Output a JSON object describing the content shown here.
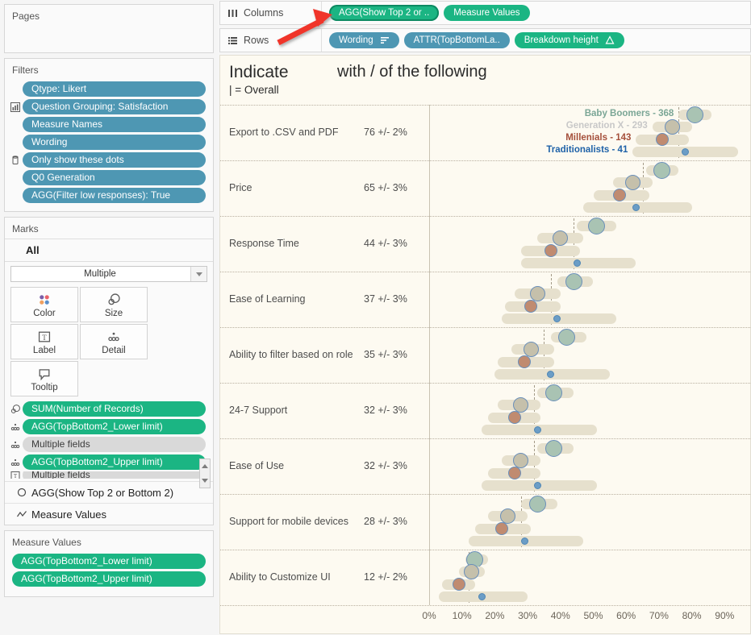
{
  "left_pane": {
    "pages": {
      "title": "Pages"
    },
    "filters": {
      "title": "Filters",
      "items": [
        {
          "label": "Qtype: Likert",
          "icon": "",
          "style": "blue"
        },
        {
          "label": "Question Grouping: Satisfaction",
          "icon": "chart-icon",
          "style": "blue"
        },
        {
          "label": "Measure Names",
          "icon": "",
          "style": "blue"
        },
        {
          "label": "Wording",
          "icon": "",
          "style": "blue"
        },
        {
          "label": "Only show these dots",
          "icon": "database-icon",
          "style": "blue"
        },
        {
          "label": "Q0 Generation",
          "icon": "",
          "style": "blue"
        },
        {
          "label": "AGG(Filter low responses): True",
          "icon": "",
          "style": "blue"
        }
      ]
    },
    "marks": {
      "title": "Marks",
      "all_label": "All",
      "mark_type": "Multiple",
      "buttons": [
        {
          "label": "Color",
          "icon": "color-dots-icon"
        },
        {
          "label": "Size",
          "icon": "size-circles-icon"
        },
        {
          "label": "Label",
          "icon": "label-text-icon"
        },
        {
          "label": "Detail",
          "icon": "detail-dots-icon"
        },
        {
          "label": "Tooltip",
          "icon": "tooltip-bubble-icon"
        }
      ],
      "pills": [
        {
          "label": "SUM(Number of Records)",
          "icon": "size-circles-icon",
          "style": "green"
        },
        {
          "label": "AGG(TopBottom2_Lower limit)",
          "icon": "detail-dots-icon",
          "style": "green"
        },
        {
          "label": "Multiple fields",
          "icon": "detail-dots-icon",
          "style": "grey"
        },
        {
          "label": "AGG(TopBottom2_Upper limit)",
          "icon": "detail-dots-icon",
          "style": "green"
        },
        {
          "label": "Multiple fields",
          "icon": "label-text-icon",
          "style": "grey"
        }
      ],
      "extra_rows": [
        {
          "label": "AGG(Show Top 2 or Bottom 2)",
          "icon": "circle-outline-icon"
        },
        {
          "label": "Measure Values",
          "icon": "line-chart-icon"
        }
      ]
    },
    "measure_values": {
      "title": "Measure Values",
      "items": [
        {
          "label": "AGG(TopBottom2_Lower limit)",
          "style": "green"
        },
        {
          "label": "AGG(TopBottom2_Upper limit)",
          "style": "green"
        }
      ]
    }
  },
  "shelves": {
    "columns": {
      "label": "Columns",
      "icon": "columns-icon",
      "pills": [
        {
          "label": "AGG(Show Top 2 or ..",
          "style": "green",
          "selected": true
        },
        {
          "label": "Measure Values",
          "style": "green",
          "selected": false
        }
      ]
    },
    "rows": {
      "label": "Rows",
      "icon": "rows-icon",
      "pills": [
        {
          "label": "Wording",
          "style": "blue",
          "selected": false,
          "badge": "sort-icon"
        },
        {
          "label": "ATTR(TopBottomLa..",
          "style": "blue",
          "selected": false
        },
        {
          "label": "Breakdown height",
          "style": "green",
          "selected": false,
          "badge": "delta-icon"
        }
      ]
    }
  },
  "annotation": {
    "arrow_color": "#f0342c",
    "name": "red-arrow-pointing-to-columns-pill"
  },
  "viz": {
    "title_main": "Indicate",
    "title_right": "with / of the following",
    "title_sub": "| = Overall",
    "generation_legend": [
      {
        "name": "Baby Boomers",
        "value": 368,
        "color": "#7ba696"
      },
      {
        "name": "Generation X",
        "value": 293,
        "color": "#c8c8c8"
      },
      {
        "name": "Millenials",
        "value": 143,
        "color": "#a5503b"
      },
      {
        "name": "Traditionalists",
        "value": 41,
        "color": "#1f62a8"
      }
    ]
  },
  "chart_data": {
    "type": "bar",
    "title": "Indicate with / of the following",
    "subtitle": "| = Overall",
    "xlabel": "",
    "ylabel": "",
    "xlim": [
      0,
      95
    ],
    "grid": true,
    "legend_position": "in-plot-top-right",
    "xticks": [
      "0%",
      "10%",
      "20%",
      "30%",
      "40%",
      "50%",
      "60%",
      "70%",
      "80%",
      "90%"
    ],
    "xtick_values": [
      0,
      10,
      20,
      30,
      40,
      50,
      60,
      70,
      80,
      90
    ],
    "categories": [
      "Export to .CSV and PDF",
      "Price",
      "Response Time",
      "Ease of Learning",
      "Ability to filter based on role",
      "24-7 Support",
      "Ease of Use",
      "Support for mobile devices",
      "Ability to Customize UI"
    ],
    "overall_values": [
      "76 +/- 2%",
      "65 +/- 3%",
      "44 +/- 3%",
      "37 +/- 3%",
      "35 +/- 3%",
      "32 +/- 3%",
      "32 +/- 3%",
      "28 +/- 3%",
      "12 +/- 2%"
    ],
    "overall_reference": [
      76,
      65,
      44,
      37,
      35,
      32,
      32,
      28,
      12
    ],
    "series": [
      {
        "name": "Baby Boomers",
        "n": 368,
        "color": "#a9c3b3",
        "values": [
          81,
          71,
          51,
          44,
          42,
          38,
          38,
          33,
          14
        ],
        "lower": [
          76,
          66,
          45,
          39,
          37,
          33,
          33,
          28,
          11
        ],
        "upper": [
          86,
          76,
          57,
          50,
          48,
          44,
          44,
          39,
          18
        ]
      },
      {
        "name": "Generation X",
        "n": 293,
        "color": "#c5c0ab",
        "values": [
          74,
          62,
          40,
          33,
          31,
          28,
          28,
          24,
          13
        ],
        "lower": [
          68,
          56,
          33,
          26,
          25,
          21,
          22,
          18,
          9
        ],
        "upper": [
          80,
          68,
          47,
          40,
          38,
          34,
          34,
          30,
          17
        ]
      },
      {
        "name": "Millenials",
        "n": 143,
        "color": "#c08b70",
        "values": [
          71,
          58,
          37,
          31,
          29,
          26,
          26,
          22,
          9
        ],
        "lower": [
          63,
          50,
          28,
          23,
          21,
          18,
          18,
          14,
          4
        ],
        "upper": [
          79,
          67,
          46,
          40,
          38,
          34,
          34,
          31,
          14
        ]
      },
      {
        "name": "Traditionalists",
        "n": 41,
        "color": "#6b9dc6",
        "values": [
          78,
          63,
          45,
          39,
          37,
          33,
          33,
          29,
          16
        ],
        "lower": [
          62,
          47,
          28,
          22,
          20,
          16,
          16,
          12,
          3
        ],
        "upper": [
          94,
          80,
          63,
          57,
          55,
          51,
          51,
          47,
          30
        ]
      }
    ]
  }
}
